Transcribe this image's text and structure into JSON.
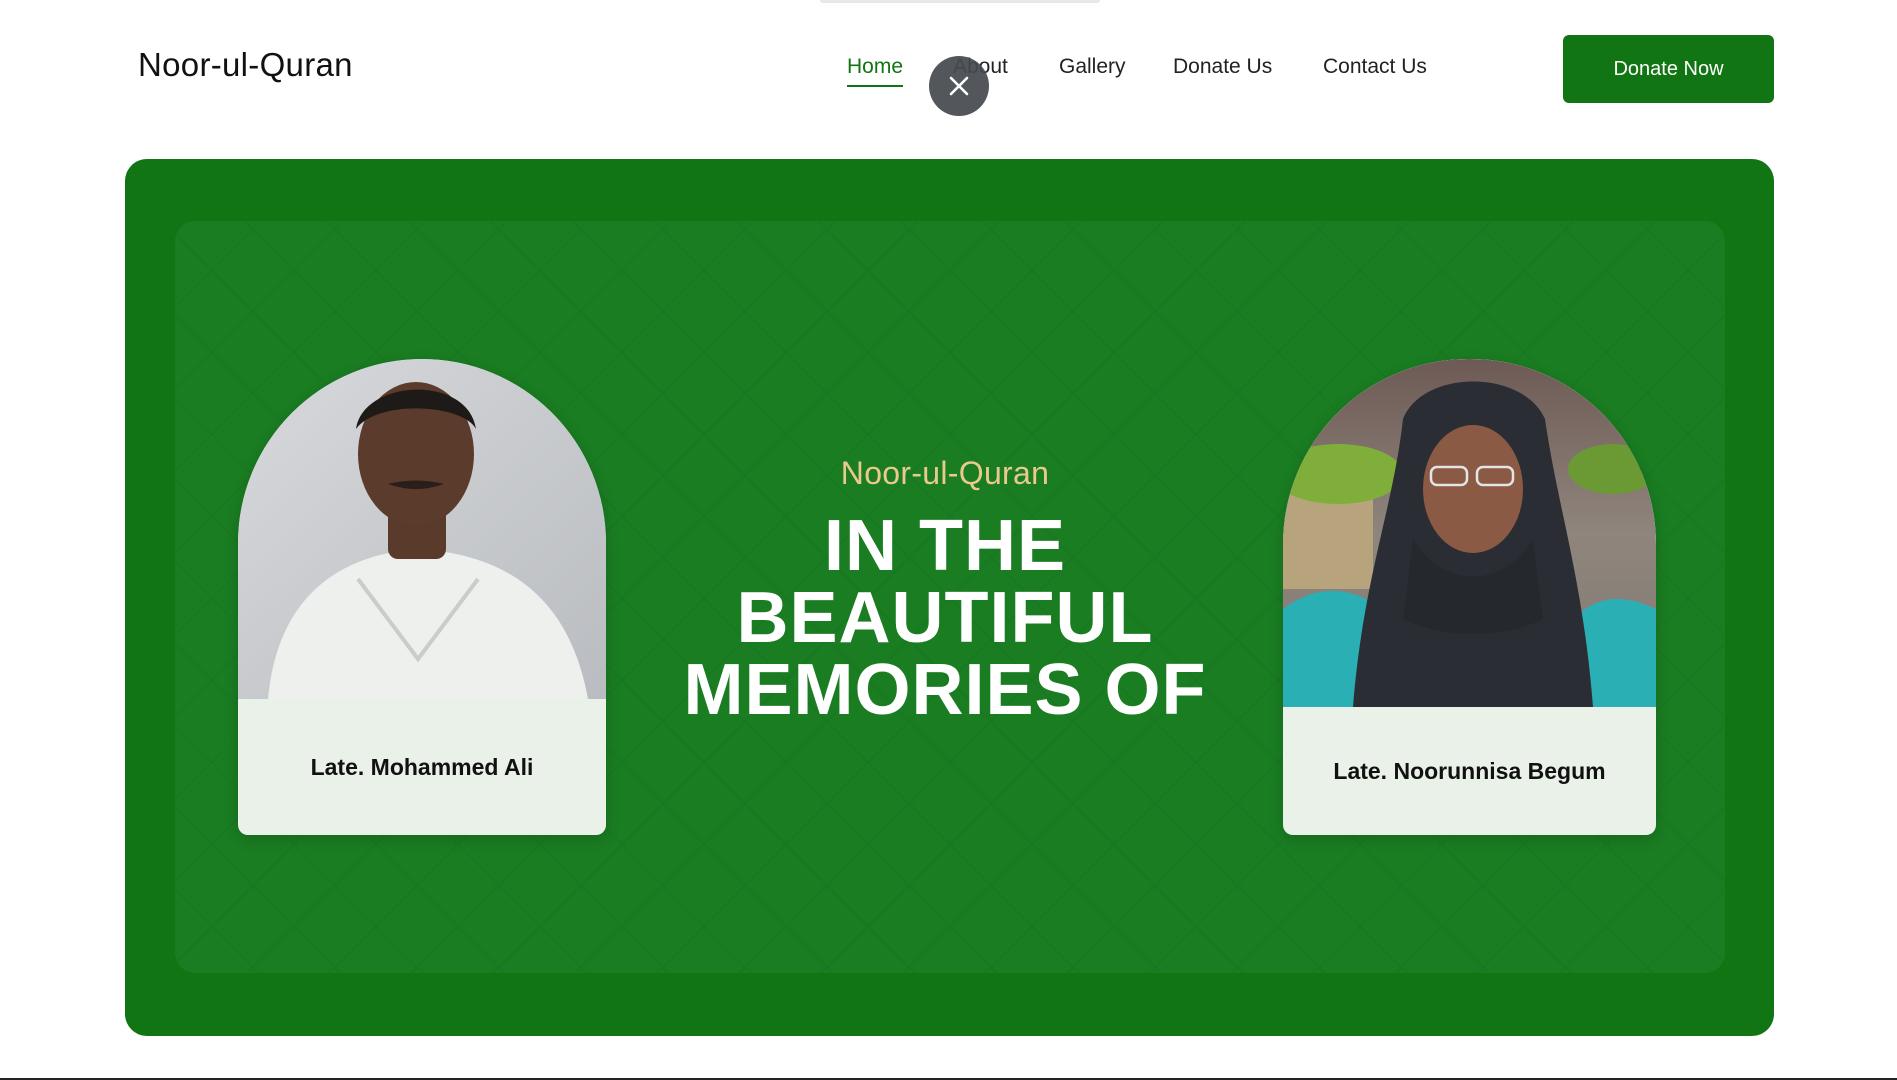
{
  "header": {
    "logo": "Noor-ul-Quran",
    "nav": [
      "Home",
      "About",
      "Gallery",
      "Donate Us",
      "Contact Us"
    ],
    "active_nav": "Home",
    "donate_button": "Donate Now"
  },
  "hero": {
    "subtitle": "Noor-ul-Quran",
    "headline": [
      "IN THE",
      "BEAUTIFUL",
      "MEMORIES OF"
    ],
    "left_card": {
      "name": "Late. Mohammed Ali"
    },
    "right_card": {
      "name": "Late. Noorunnisa Begum"
    }
  },
  "colors": {
    "brand_green": "#107512",
    "subtitle_gold": "#eac98c",
    "card_bg": "#e9f1e9"
  },
  "icons": {
    "overlay_close": "close-icon"
  }
}
